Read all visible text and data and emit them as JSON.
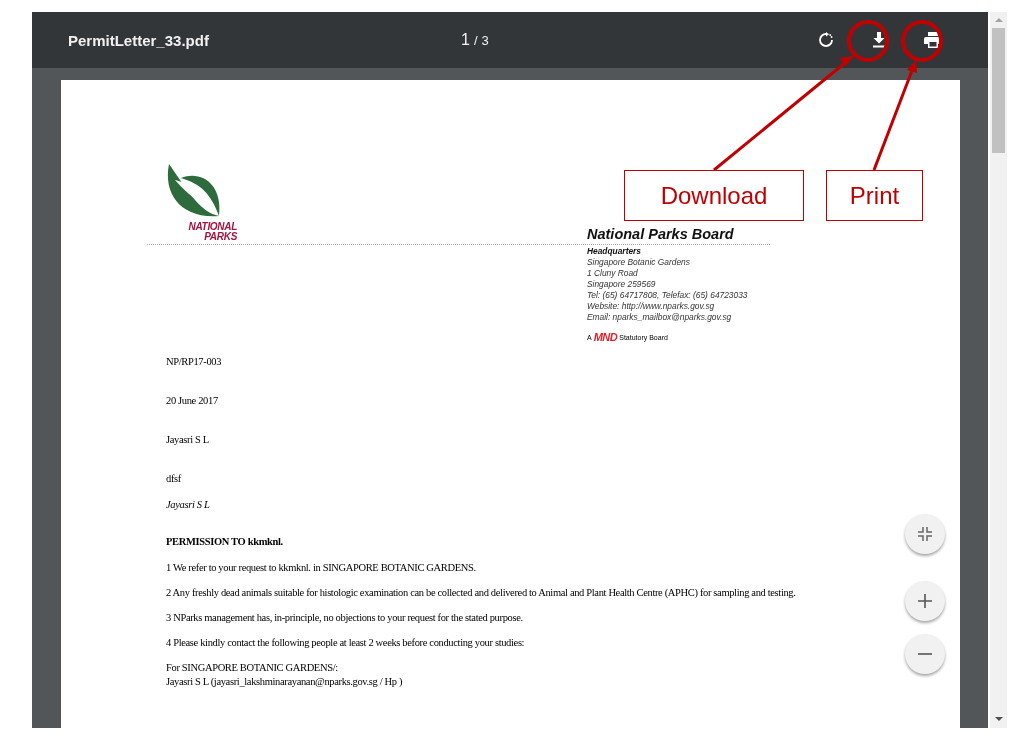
{
  "toolbar": {
    "filename": "PermitLetter_33.pdf",
    "page_current": "1",
    "page_separator": "/",
    "page_total": "3"
  },
  "letterhead": {
    "logo_text": [
      "NATIONAL",
      "PARKS"
    ],
    "organisation": "National Parks Board",
    "address": [
      {
        "text": "Headquarters",
        "kind": "bold"
      },
      {
        "text": "Singapore Botanic Gardens",
        "kind": "plain"
      },
      {
        "text": "1 Cluny Road",
        "kind": "plain"
      },
      {
        "text": "Singapore 259569",
        "kind": "plain"
      },
      {
        "text": "Tel: (65) 64717808, Telefax: (65) 64723033",
        "kind": "plain"
      },
      {
        "text": "Website: http://www.nparks.gov.sg",
        "kind": "plain"
      },
      {
        "text": "Email: nparks_mailbox@nparks.gov.sg",
        "kind": "plain"
      }
    ],
    "ministry": {
      "prefix": "A",
      "logo": "MND",
      "suffix": "Statutory Board"
    }
  },
  "body": [
    {
      "kind": "reference",
      "lines": [
        "NP/RP17-003"
      ]
    },
    {
      "kind": "date",
      "lines": [
        "20 June 2017"
      ]
    },
    {
      "kind": "name",
      "lines": [
        "Jayasri S L"
      ]
    },
    {
      "kind": "text",
      "lines": [
        "dfsf"
      ]
    },
    {
      "kind": "signature",
      "lines": [
        "Jayasri S L"
      ]
    },
    {
      "kind": "heading",
      "lines": [
        "PERMISSION TO kkmknl."
      ]
    },
    {
      "kind": "paragraph",
      "lines": [
        "1 We refer to your request to kkmknl. in SINGAPORE BOTANIC GARDENS."
      ]
    },
    {
      "kind": "paragraph",
      "lines": [
        "2 Any freshly dead animals suitable for histologic examination can be collected and delivered to Animal and Plant Health Centre (APHC) for sampling and testing."
      ]
    },
    {
      "kind": "paragraph",
      "lines": [
        "3 NParks management has, in-principle, no objections to your request for the stated purpose."
      ]
    },
    {
      "kind": "paragraph",
      "lines": [
        "4 Please kindly contact the following people at least 2 weeks before conducting your studies:"
      ]
    },
    {
      "kind": "paragraph",
      "lines": [
        "For SINGAPORE BOTANIC GARDENS/:",
        "Jayasri S L (jayasri_lakshminarayanan@nparks.gov.sg / Hp )"
      ]
    }
  ],
  "callouts": [
    {
      "label": "Download"
    },
    {
      "label": "Print"
    }
  ]
}
